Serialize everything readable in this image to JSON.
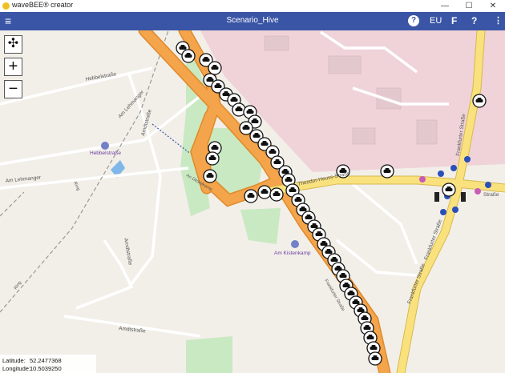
{
  "window": {
    "app_title": "waveBEE® creator",
    "minimize": "—",
    "maximize": "☐",
    "close": "✕"
  },
  "appbar": {
    "menu_icon": "≡",
    "scenario_title": "Scenario_Hive",
    "help_icon": "?",
    "region": "EU",
    "f_button": "F",
    "question_button": "?",
    "more_icon": "⋮"
  },
  "map_controls": {
    "fit_icon": "✣",
    "zoom_in": "+",
    "zoom_out": "−"
  },
  "map_labels": {
    "hebbelstrasse_top": "Hebbelstraße",
    "am_lehmanger_diag": "Am Lehmanger",
    "arndtstrasse_v": "Arndtstraße",
    "hebbelstrasse_stop": "Hebbelstraße",
    "am_lehmanger": "Am Lehmanger",
    "ring": "Ring",
    "ring2": "Ring",
    "arndtstrasse_mid": "Arndtstraße",
    "amdtstrasse_bottom": "Amdtstraße",
    "an_dickelmann": "An Dickelkamp",
    "hausse": "Theodor-Heuss-Straße",
    "am_kistenkamp": "Am Kistenkamp",
    "frankfurter_bridge": "Frankfurter Straße",
    "frankfurter_left": "Frankfurter Straße",
    "frankfurter_right": "Frankfurter Straße",
    "frankfurter_top": "Frankfurter Straße",
    "strasse_right": "Straße"
  },
  "status": {
    "latitude_label": "Latitude:",
    "latitude_value": "52.2477368",
    "longitude_label": "Longitude:",
    "longitude_value": "10.5039250"
  },
  "colors": {
    "appbar": "#3a55a6",
    "highway": "#f4a44a",
    "primary_road": "#f9e27e",
    "map_bg": "#f2efe9",
    "urban": "#f0d6da",
    "park": "#c9e9c2",
    "vehicle_marker": "#111111",
    "node_blue": "#2a4fb8",
    "node_pink": "#c85ab8"
  }
}
